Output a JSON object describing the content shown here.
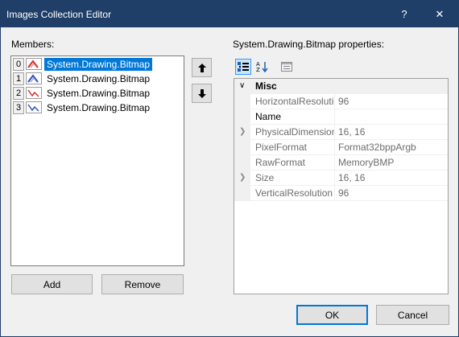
{
  "window": {
    "title": "Images Collection Editor",
    "help_glyph": "?",
    "close_glyph": "✕"
  },
  "members": {
    "label": "Members:",
    "items": [
      {
        "index": "0",
        "text": "System.Drawing.Bitmap",
        "selected": true
      },
      {
        "index": "1",
        "text": "System.Drawing.Bitmap",
        "selected": false
      },
      {
        "index": "2",
        "text": "System.Drawing.Bitmap",
        "selected": false
      },
      {
        "index": "3",
        "text": "System.Drawing.Bitmap",
        "selected": false
      }
    ],
    "add_label": "Add",
    "remove_label": "Remove"
  },
  "properties": {
    "label": "System.Drawing.Bitmap properties:",
    "category": "Misc",
    "rows": [
      {
        "name": "HorizontalResolution",
        "value": "96",
        "expandable": false,
        "editable": false
      },
      {
        "name": "Name",
        "value": "",
        "expandable": false,
        "editable": true
      },
      {
        "name": "PhysicalDimension",
        "value": "16, 16",
        "expandable": true,
        "editable": false
      },
      {
        "name": "PixelFormat",
        "value": "Format32bppArgb",
        "expandable": false,
        "editable": false
      },
      {
        "name": "RawFormat",
        "value": "MemoryBMP",
        "expandable": false,
        "editable": false
      },
      {
        "name": "Size",
        "value": "16, 16",
        "expandable": true,
        "editable": false
      },
      {
        "name": "VerticalResolution",
        "value": "96",
        "expandable": false,
        "editable": false
      }
    ]
  },
  "footer": {
    "ok_label": "OK",
    "cancel_label": "Cancel"
  },
  "colors": {
    "titlebar": "#1f3e68",
    "selection": "#0078d7"
  }
}
